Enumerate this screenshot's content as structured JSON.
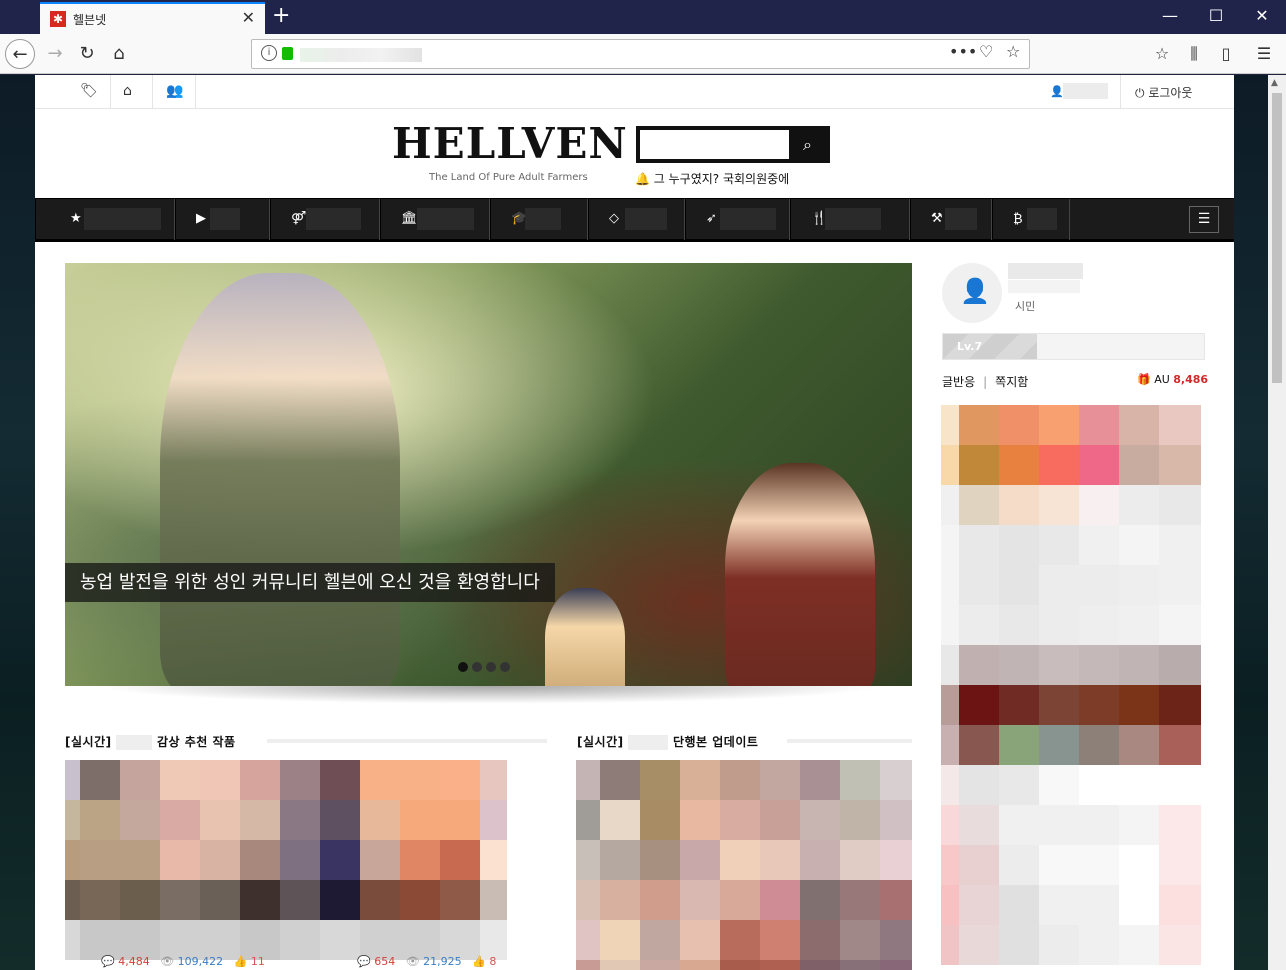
{
  "browser": {
    "tab_title": "헬븐넷",
    "tab_favicon": "✱",
    "new_tab": "+",
    "window_controls": [
      "—",
      "☐",
      "✕"
    ]
  },
  "site": {
    "logo": "HELLVEN",
    "tagline": "The Land Of Pure Adult Farmers",
    "notice": "그 누구였지? 국회의원중에",
    "logout": "로그아웃",
    "hero_caption": "농업 발전을 위한 성인 커뮤니티 헬븐에 오신 것을 환영합니다",
    "hero_slides": 4,
    "hero_active_slide": 1,
    "sections": [
      {
        "prefix": "[실시간]",
        "suffix": "감상 추천 작품"
      },
      {
        "prefix": "[실시간]",
        "suffix": "단행본 업데이트"
      }
    ],
    "stats": [
      {
        "comments": "4,484",
        "views": "109,422",
        "likes": "11"
      },
      {
        "comments": "654",
        "views": "21,925",
        "likes": "8"
      }
    ]
  },
  "sidebar": {
    "rank": "시민",
    "level": "Lv.7",
    "level_progress": 0.36,
    "link_reactions": "글반응",
    "link_messages": "쪽지함",
    "au_label": "AU",
    "au_value": "8,486"
  },
  "colors": {
    "accent": "#0a84ff",
    "nav_bg": "#1b1b1b",
    "au_red": "#d02a2a"
  },
  "icons": {
    "util": [
      "tags-icon",
      "inbox-icon",
      "users-icon"
    ],
    "nav": [
      "star-icon",
      "youtube-icon",
      "gender-icon",
      "bank-icon",
      "graduation-cap-icon",
      "diamond-icon",
      "rocket-icon",
      "utensils-icon",
      "gavel-icon",
      "bitcoin-icon"
    ]
  }
}
